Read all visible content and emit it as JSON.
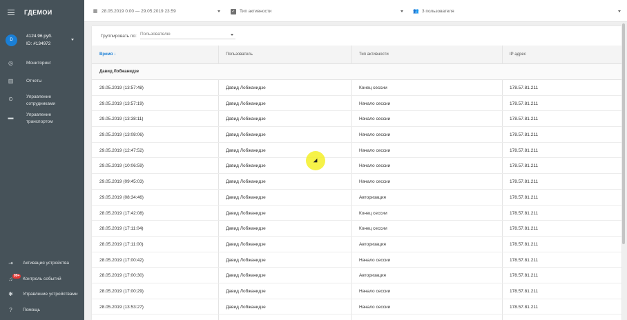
{
  "sidebar": {
    "logo": "ГДЕМОИ",
    "account": {
      "avatar": "D",
      "balance": "4124.96 руб.",
      "id": "ID: #134972"
    },
    "nav": [
      {
        "icon": "globe-icon",
        "label": "Мониторинг"
      },
      {
        "icon": "chart-icon",
        "label": "Отчеты"
      },
      {
        "icon": "pin-icon",
        "label": "Управление сотрудниками"
      },
      {
        "icon": "car-icon",
        "label": "Управление транспортом"
      }
    ],
    "bottom": [
      {
        "icon": "login-icon",
        "label": "Активация устройства"
      },
      {
        "icon": "bell-icon",
        "label": "Контроль событий",
        "badge": "99+"
      },
      {
        "icon": "gear-icon",
        "label": "Управление устройствами"
      },
      {
        "icon": "help-icon",
        "label": "Помощь"
      }
    ]
  },
  "filters": {
    "date_range": "28.05.2019 0:00 — 29.05.2019 23:59",
    "activity_type": "Тип активности",
    "users": "3 пользователя"
  },
  "group_by": {
    "label": "Группировать по:",
    "value": "Пользователю"
  },
  "table": {
    "columns": [
      "Время",
      "Пользователь",
      "Тип активности",
      "IP адрес"
    ],
    "group": "Давид Лобжанидзе",
    "rows": [
      [
        "29.05.2019 (13:57:48)",
        "Давид Лобжанидзе",
        "Конец сессии",
        "178.57.81.211"
      ],
      [
        "29.05.2019 (13:57:19)",
        "Давид Лобжанидзе",
        "Начало сессии",
        "178.57.81.211"
      ],
      [
        "29.05.2019 (13:38:11)",
        "Давид Лобжанидзе",
        "Начало сессии",
        "178.57.81.211"
      ],
      [
        "29.05.2019 (13:08:06)",
        "Давид Лобжанидзе",
        "Начало сессии",
        "178.57.81.211"
      ],
      [
        "29.05.2019 (12:47:52)",
        "Давид Лобжанидзе",
        "Начало сессии",
        "178.57.81.211"
      ],
      [
        "29.05.2019 (10:06:59)",
        "Давид Лобжанидзе",
        "Начало сессии",
        "178.57.81.211"
      ],
      [
        "29.05.2019 (09:45:03)",
        "Давид Лобжанидзе",
        "Начало сессии",
        "178.57.81.211"
      ],
      [
        "29.05.2019 (08:34:46)",
        "Давид Лобжанидзе",
        "Авторизация",
        "178.57.81.211"
      ],
      [
        "28.05.2019 (17:42:08)",
        "Давид Лобжанидзе",
        "Конец сессии",
        "178.57.81.211"
      ],
      [
        "28.05.2019 (17:11:04)",
        "Давид Лобжанидзе",
        "Конец сессии",
        "178.57.81.211"
      ],
      [
        "28.05.2019 (17:11:00)",
        "Давид Лобжанидзе",
        "Авторизация",
        "178.57.81.211"
      ],
      [
        "28.05.2019 (17:00:42)",
        "Давид Лобжанидзе",
        "Начало сессии",
        "178.57.81.211"
      ],
      [
        "28.05.2019 (17:00:30)",
        "Давид Лобжанидзе",
        "Авторизация",
        "178.57.81.211"
      ],
      [
        "28.05.2019 (17:00:29)",
        "Давид Лобжанидзе",
        "Начало сессии",
        "178.57.81.211"
      ],
      [
        "28.05.2019 (13:53:27)",
        "Давид Лобжанидзе",
        "Начало сессии",
        "178.57.81.211"
      ]
    ]
  },
  "colors": {
    "sidebar": "#465259",
    "accent": "#1a7fd6",
    "badge": "#e53935"
  }
}
